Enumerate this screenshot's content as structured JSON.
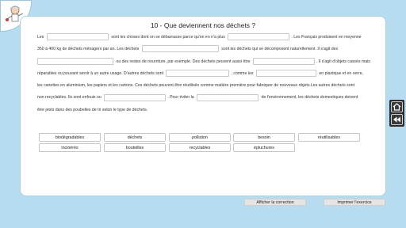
{
  "title": "10 - Que deviennent nos déchets ?",
  "text": {
    "l1a": "Les",
    "l1b": "sont les choses dont on se débarrasse parce qu'on en n'a plus",
    "l1c": ". Les Français produisent en moyenne",
    "l2a": "350 à 400 kg de déchets ménagers par an. Les déchets",
    "l2b": "sont les déchets qui se décomposent naturellement. Il s'agit des",
    "l3a": "ou des restes de nourriture, par exemple. Des déchets peuvent aussi être",
    "l3b": ". Il s'agit d'objets cassés mais",
    "l4a": "réparables ou pouvant servir à un autre usage. D'autres déchets sont",
    "l4b": ", comme les",
    "l4c": "en plastique et en verre,",
    "l5": "les canettes en aluminium, les papiers et les cartons. Ces déchets peuvent être réutilisés comme matière première pour fabriquer de nouveaux objets.Les autres déchets sont",
    "l6a": "non recyclables. Ils sont enfouis ou",
    "l6b": ". Pour éviter la",
    "l6c": "de l'environnement, les déchets domestiques doivent",
    "l7": "être jetés dans des poubelles de tri selon le type de déchets."
  },
  "word_bank": [
    "biodégradables",
    "déchets",
    "pollution",
    "besoin",
    "réutilisables",
    "incinérés",
    "bouteilles",
    "recyclables",
    "épluchures"
  ],
  "buttons": {
    "show_correction": "Afficher la correction",
    "print": "Imprimer l'exercice"
  },
  "icons": {
    "logo": "scientist-mascot-icon",
    "home": "home-icon",
    "back": "rewind-icon"
  }
}
